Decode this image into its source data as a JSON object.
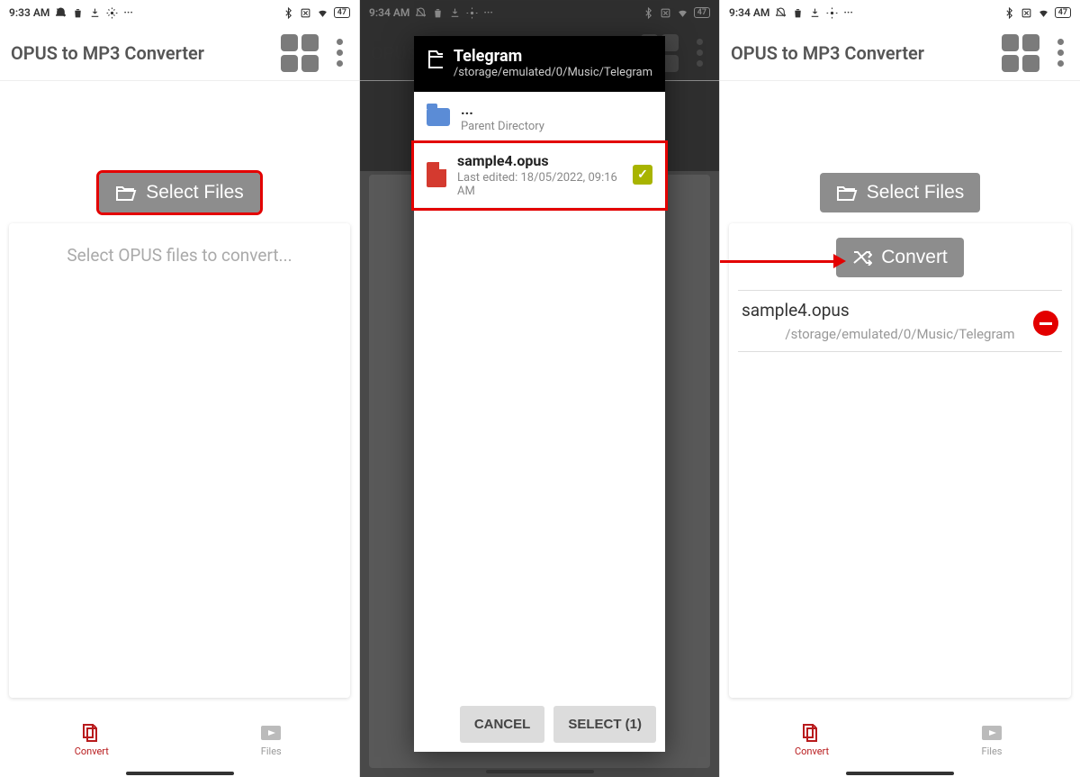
{
  "status": {
    "time_a": "9:33 AM",
    "time_b": "9:34 AM",
    "battery": "47"
  },
  "app": {
    "title": "OPUS to MP3 Converter"
  },
  "buttons": {
    "select_files": "Select Files",
    "convert": "Convert"
  },
  "placeholder": "Select OPUS files to convert...",
  "nav": {
    "convert": "Convert",
    "files": "Files"
  },
  "dialog": {
    "title": "Telegram",
    "path": "/storage/emulated/0/Music/Telegram",
    "parent_dots": "...",
    "parent_label": "Parent Directory",
    "file_name": "sample4.opus",
    "file_meta": "Last edited: 18/05/2022, 09:16 AM",
    "cancel": "CANCEL",
    "select": "SELECT (1)"
  },
  "selected": {
    "name": "sample4.opus",
    "path": "/storage/emulated/0/Music/Telegram"
  }
}
